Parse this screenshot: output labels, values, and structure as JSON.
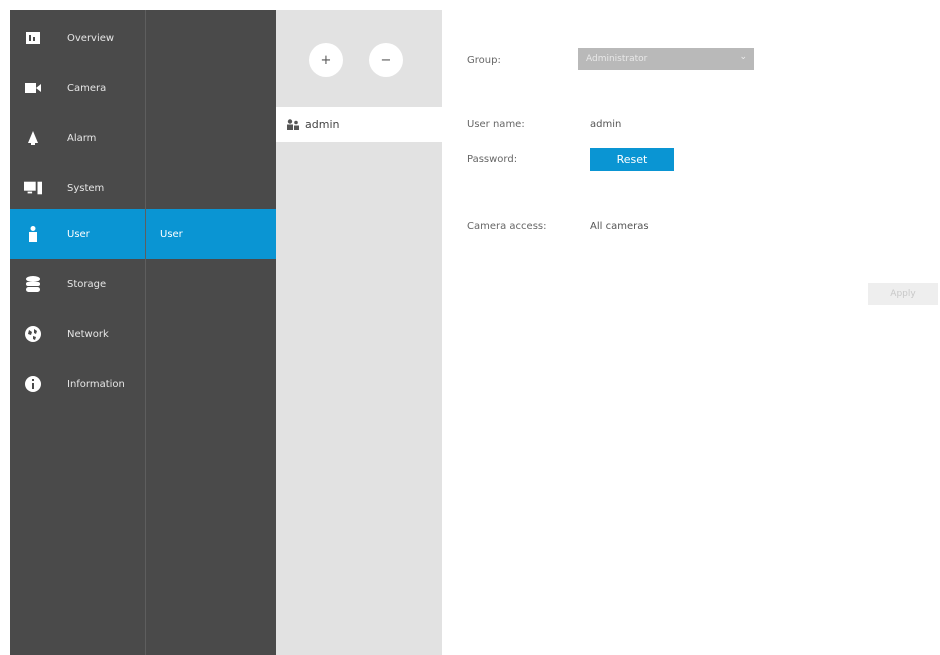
{
  "nav": {
    "items": [
      {
        "label": "Overview",
        "icon": "overview-icon"
      },
      {
        "label": "Camera",
        "icon": "camera-icon"
      },
      {
        "label": "Alarm",
        "icon": "bell-icon"
      },
      {
        "label": "System",
        "icon": "monitor-icon"
      },
      {
        "label": "User",
        "icon": "user-icon"
      },
      {
        "label": "Storage",
        "icon": "database-icon"
      },
      {
        "label": "Network",
        "icon": "globe-icon"
      },
      {
        "label": "Information",
        "icon": "info-icon"
      }
    ],
    "active": "User"
  },
  "subnav": {
    "items": [
      {
        "label": "User"
      }
    ]
  },
  "users": {
    "add_label": "+",
    "remove_label": "−",
    "list": [
      {
        "name": "admin"
      }
    ]
  },
  "form": {
    "group_label": "Group:",
    "group_value": "Administrator",
    "username_label": "User name:",
    "username_value": "admin",
    "password_label": "Password:",
    "reset_label": "Reset",
    "camera_access_label": "Camera access:",
    "camera_access_value": "All cameras",
    "apply_label": "Apply"
  },
  "colors": {
    "accent": "#0a95d3",
    "sidebar": "#4a4a4a",
    "panel": "#e2e2e2"
  }
}
